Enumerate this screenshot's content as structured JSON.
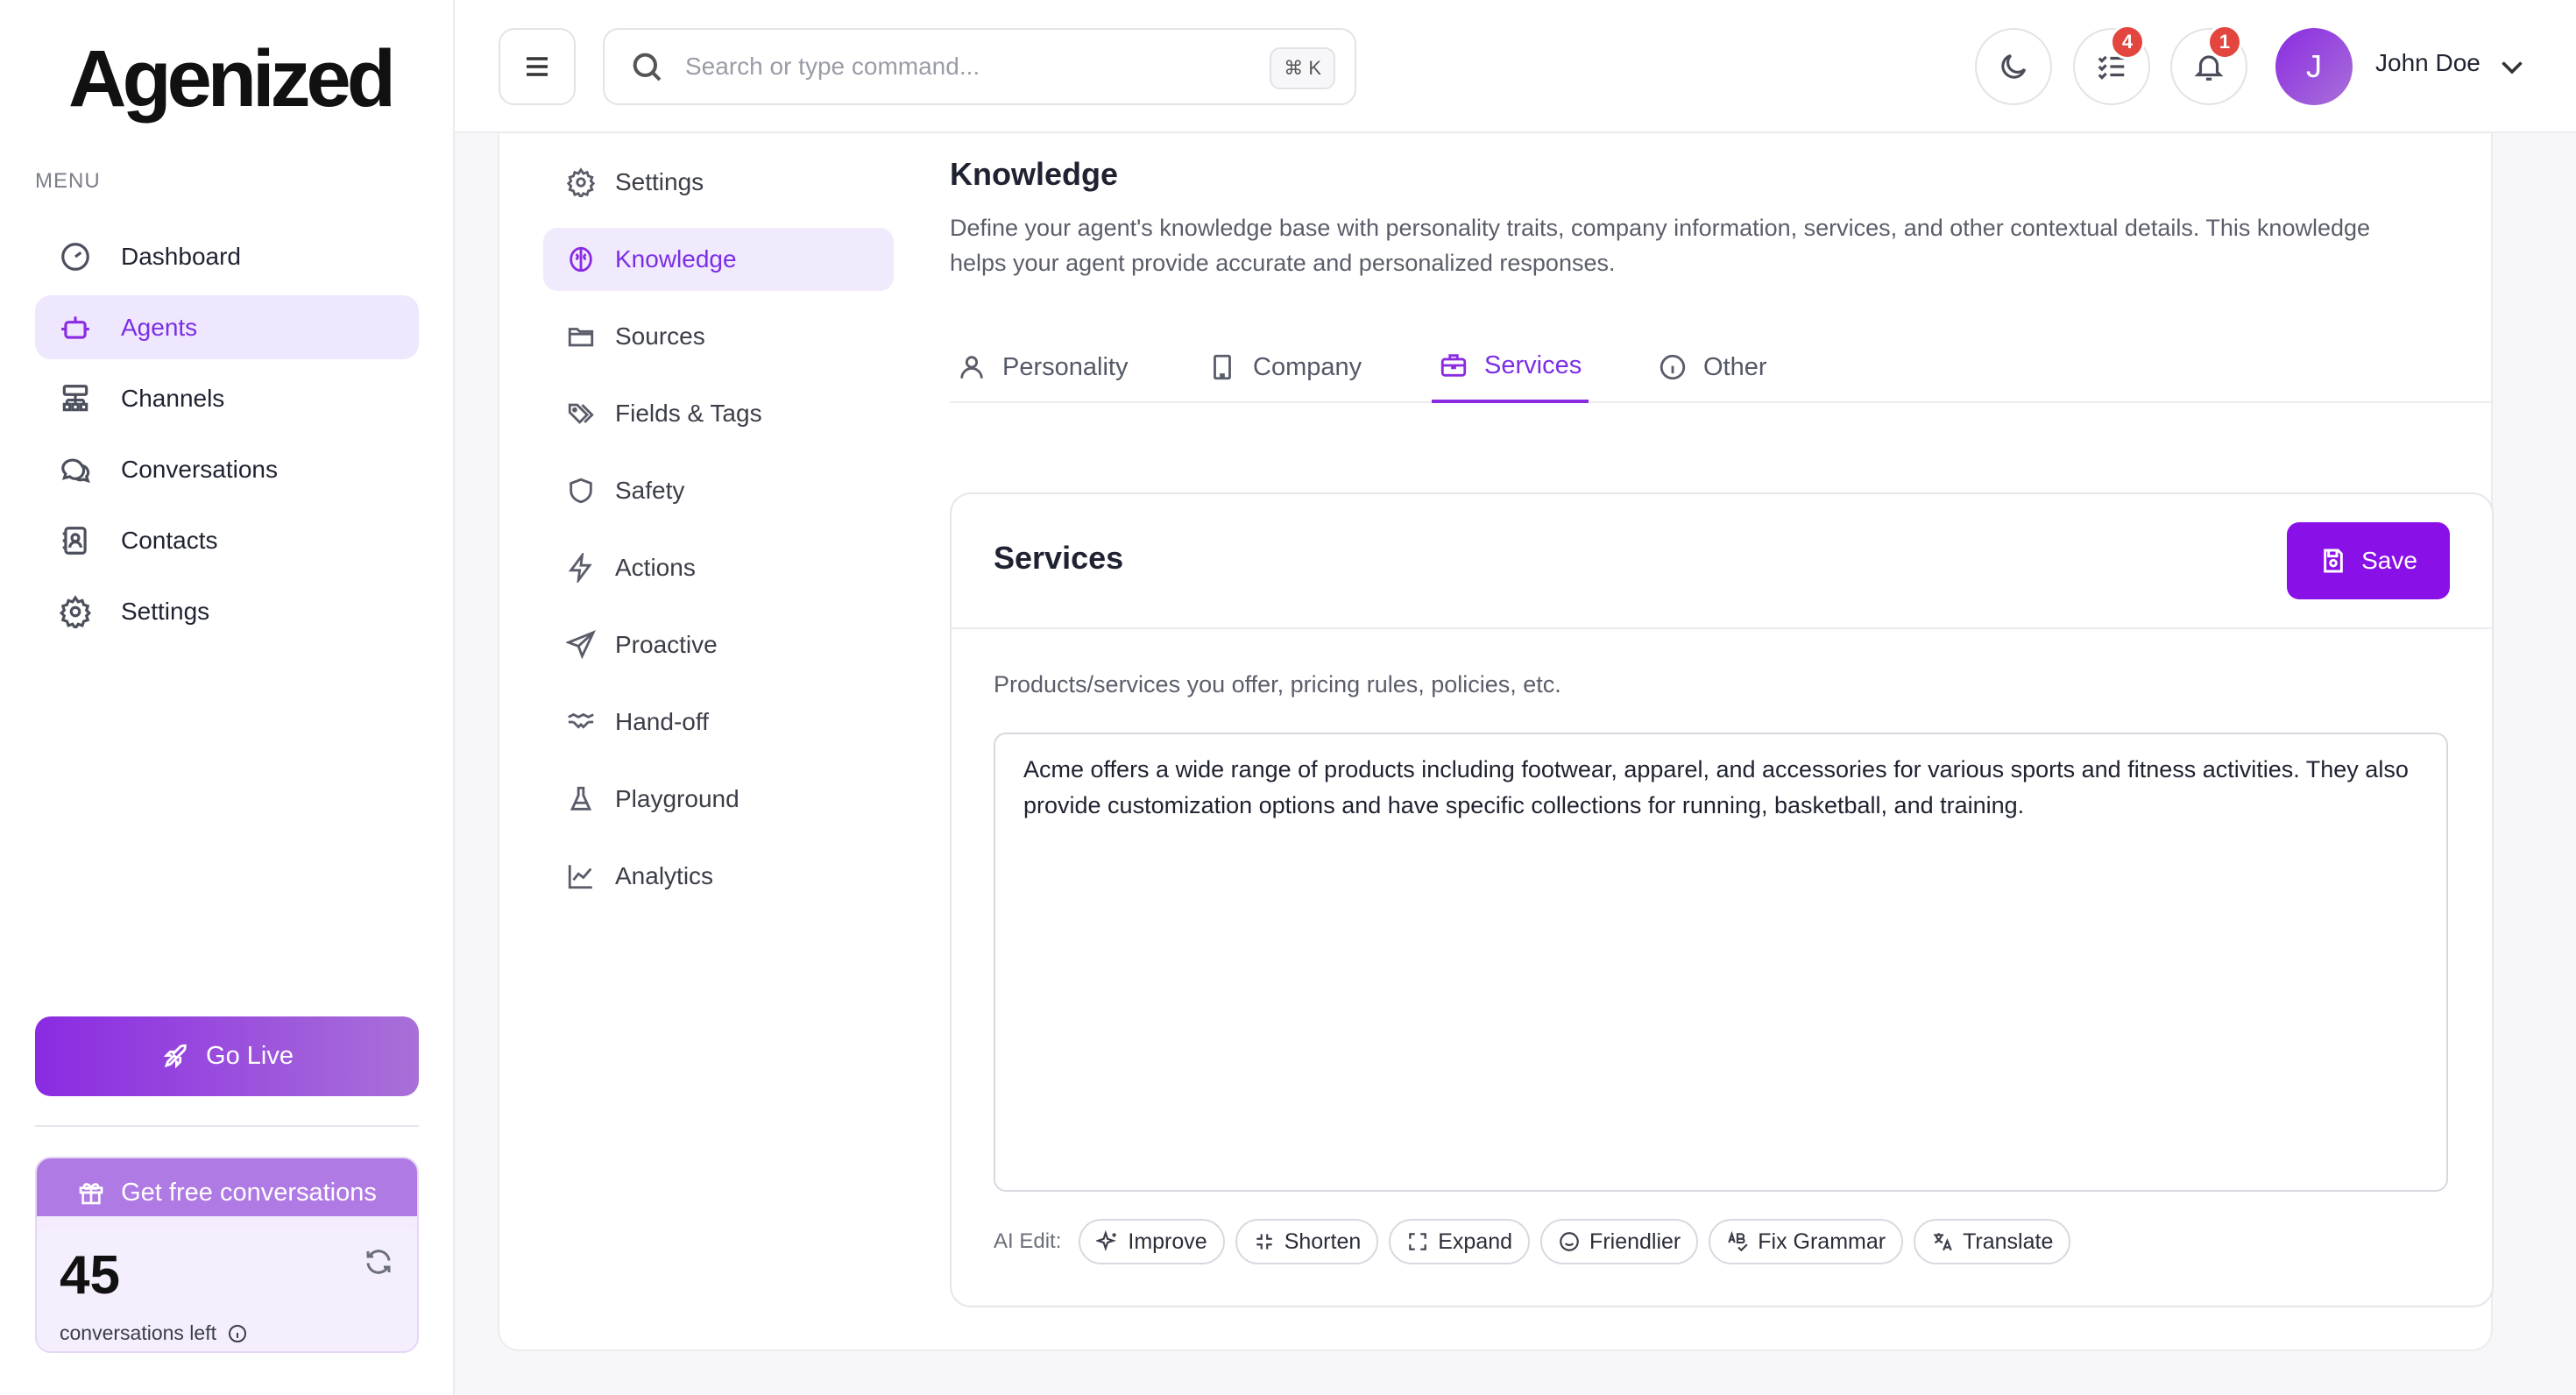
{
  "brand": {
    "logo_text": "Agenized"
  },
  "sidebar": {
    "menu_label": "MENU",
    "items": [
      {
        "label": "Dashboard",
        "icon": "gauge-icon"
      },
      {
        "label": "Agents",
        "icon": "robot-icon",
        "active": true
      },
      {
        "label": "Channels",
        "icon": "network-icon"
      },
      {
        "label": "Conversations",
        "icon": "chat-bubbles-icon"
      },
      {
        "label": "Contacts",
        "icon": "contact-card-icon"
      },
      {
        "label": "Settings",
        "icon": "gear-icon"
      }
    ],
    "go_live_label": "Go Live",
    "free_conversations_label": "Get free conversations",
    "conversations_left_count": "45",
    "conversations_left_label": "conversations left"
  },
  "header": {
    "search_placeholder": "Search or type command...",
    "search_shortcut": "⌘ K",
    "tasks_badge": "4",
    "notifications_badge": "1",
    "avatar_initial": "J",
    "user_name": "John Doe"
  },
  "subnav": {
    "items": [
      {
        "label": "Settings",
        "icon": "gear-icon"
      },
      {
        "label": "Knowledge",
        "icon": "brain-icon",
        "active": true
      },
      {
        "label": "Sources",
        "icon": "folder-icon"
      },
      {
        "label": "Fields & Tags",
        "icon": "tags-icon"
      },
      {
        "label": "Safety",
        "icon": "shield-icon"
      },
      {
        "label": "Actions",
        "icon": "lightning-icon"
      },
      {
        "label": "Proactive",
        "icon": "send-icon"
      },
      {
        "label": "Hand-off",
        "icon": "handshake-icon"
      },
      {
        "label": "Playground",
        "icon": "flask-icon"
      },
      {
        "label": "Analytics",
        "icon": "chart-line-icon"
      }
    ]
  },
  "knowledge": {
    "title": "Knowledge",
    "description": "Define your agent's knowledge base with personality traits, company information, services, and other contextual details. This knowledge helps your agent provide accurate and personalized responses.",
    "tabs": [
      {
        "label": "Personality",
        "icon": "user-icon"
      },
      {
        "label": "Company",
        "icon": "building-icon"
      },
      {
        "label": "Services",
        "icon": "briefcase-icon",
        "active": true
      },
      {
        "label": "Other",
        "icon": "info-icon"
      }
    ]
  },
  "services_card": {
    "title": "Services",
    "save_label": "Save",
    "field_label": "Products/services you offer, pricing rules, policies, etc.",
    "field_value": "Acme offers a wide range of products including footwear, apparel, and accessories for various sports and fitness activities. They also provide customization options and have specific collections for running, basketball, and training.",
    "ai_edit_label": "AI Edit:",
    "ai_actions": [
      {
        "label": "Improve",
        "icon": "sparkle-icon"
      },
      {
        "label": "Shorten",
        "icon": "shrink-icon"
      },
      {
        "label": "Expand",
        "icon": "expand-icon"
      },
      {
        "label": "Friendlier",
        "icon": "smile-icon"
      },
      {
        "label": "Fix Grammar",
        "icon": "spell-check-icon"
      },
      {
        "label": "Translate",
        "icon": "translate-icon"
      }
    ]
  },
  "colors": {
    "accent": "#8a2be2",
    "accent_light": "#efe7fd",
    "badge": "#e2463e"
  }
}
